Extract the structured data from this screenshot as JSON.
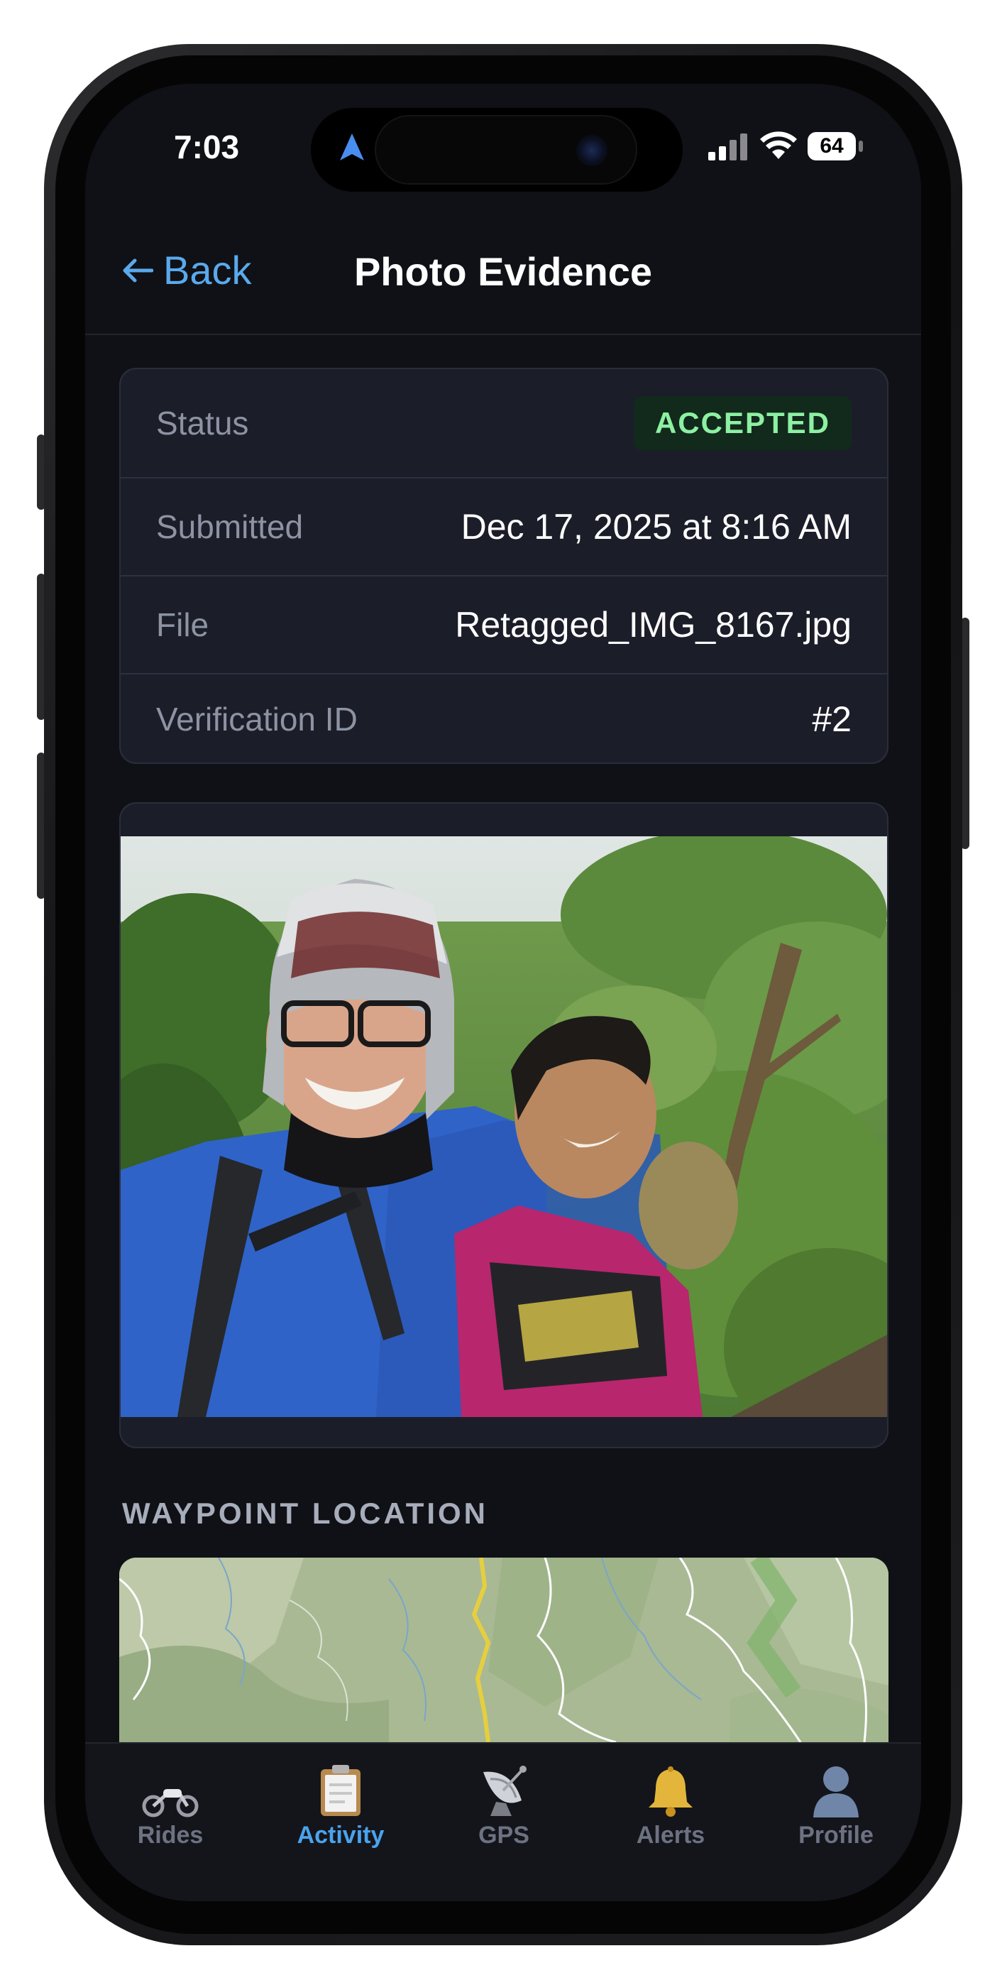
{
  "status_bar": {
    "time": "7:03",
    "battery": "64"
  },
  "nav": {
    "back_label": "Back",
    "title": "Photo Evidence"
  },
  "details": {
    "status_label": "Status",
    "status_value": "ACCEPTED",
    "submitted_label": "Submitted",
    "submitted_value": "Dec 17, 2025 at 8:16 AM",
    "file_label": "File",
    "file_value": "Retagged_IMG_8167.jpg",
    "verification_label": "Verification ID",
    "verification_value": "#2"
  },
  "photo": {
    "alt_icon": "photo-icon"
  },
  "waypoint": {
    "section_title": "WAYPOINT LOCATION"
  },
  "tabs": [
    {
      "label": "Rides",
      "icon": "motorcycle-icon",
      "active": false
    },
    {
      "label": "Activity",
      "icon": "clipboard-icon",
      "active": true
    },
    {
      "label": "GPS",
      "icon": "satellite-dish-icon",
      "active": false
    },
    {
      "label": "Alerts",
      "icon": "bell-icon",
      "active": false
    },
    {
      "label": "Profile",
      "icon": "person-icon",
      "active": false
    }
  ],
  "colors": {
    "accent": "#4aa3ec",
    "badge_bg": "#112a1b",
    "badge_text": "#8df0a3",
    "background": "#101116",
    "card": "#1b1e29"
  }
}
